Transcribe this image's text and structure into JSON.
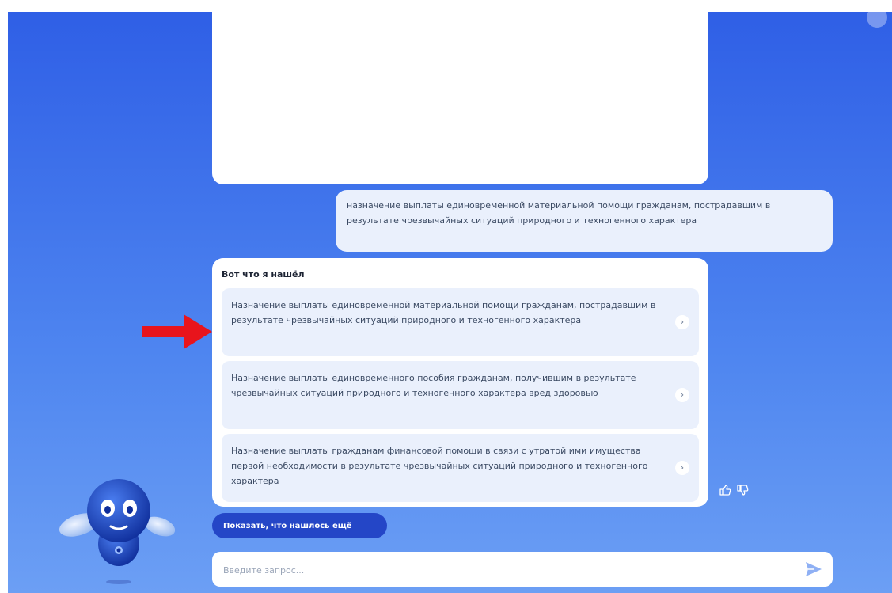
{
  "user_message": {
    "text": "назначение выплаты единовременной материальной помощи гражданам, пострадавшим в результате чрезвычайных ситуаций природного и техногенного характера"
  },
  "bot_response": {
    "title": "Вот что я нашёл",
    "options": [
      {
        "text": "Назначение выплаты единовременной материальной помощи гражданам, пострадавшим в результате чрезвычайных ситуаций природного и техногенного характера"
      },
      {
        "text": "Назначение выплаты единовременного пособия гражданам, получившим в результате чрезвычайных ситуаций природного и техногенного характера вред здоровью"
      },
      {
        "text": "Назначение выплаты гражданам финансовой помощи в связи с утратой ими имущества первой необходимости в результате чрезвычайных ситуаций природного и техногенного характера"
      }
    ],
    "option_arrow_icon": "chevron-right-icon"
  },
  "feedback": {
    "like_icon": "thumbs-up-icon",
    "dislike_icon": "thumbs-down-icon"
  },
  "show_more": {
    "label": "Показать, что нашлось ещё"
  },
  "input": {
    "placeholder": "Введите запрос...",
    "value": "",
    "send_icon": "send-icon"
  },
  "colors": {
    "background_top": "#2f5fe6",
    "background_bottom": "#6c9ff4",
    "message_bubble": "#eaf0fc",
    "button_primary": "#2446c7",
    "annotation_arrow": "#e8141c"
  }
}
